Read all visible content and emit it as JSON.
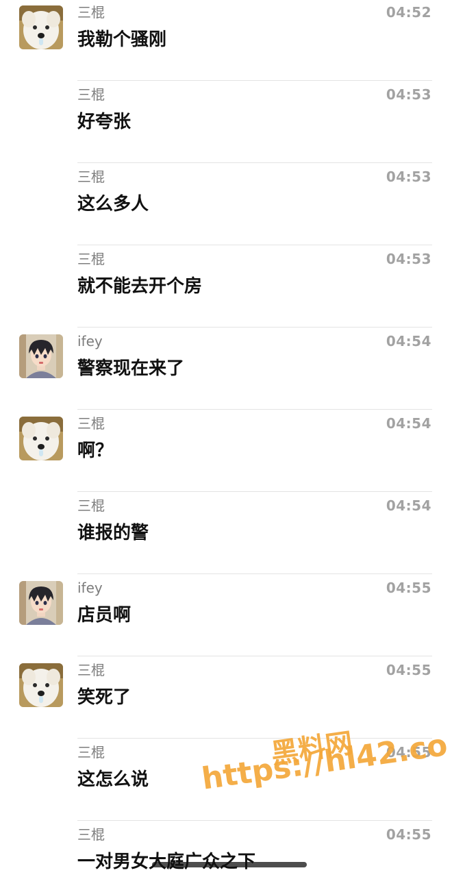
{
  "chat": {
    "messages": [
      {
        "sender": "三棍",
        "time": "04:52",
        "text": "我勒个骚刚",
        "avatar": "dog-avatar"
      },
      {
        "sender": "三棍",
        "time": "04:53",
        "text": "好夸张",
        "avatar": ""
      },
      {
        "sender": "三棍",
        "time": "04:53",
        "text": "这么多人",
        "avatar": ""
      },
      {
        "sender": "三棍",
        "time": "04:53",
        "text": "就不能去开个房",
        "avatar": ""
      },
      {
        "sender": "ifey",
        "time": "04:54",
        "text": "警察现在来了",
        "avatar": "anime-avatar"
      },
      {
        "sender": "三棍",
        "time": "04:54",
        "text": "啊？",
        "avatar": "dog-avatar"
      },
      {
        "sender": "三棍",
        "time": "04:54",
        "text": "谁报的警",
        "avatar": ""
      },
      {
        "sender": "ifey",
        "time": "04:55",
        "text": "店员啊",
        "avatar": "anime-avatar"
      },
      {
        "sender": "三棍",
        "time": "04:55",
        "text": "笑死了",
        "avatar": "dog-avatar"
      },
      {
        "sender": "三棍",
        "time": "04:55",
        "text": "这怎么说",
        "avatar": ""
      },
      {
        "sender": "三棍",
        "time": "04:55",
        "text": "一对男女大庭广众之下",
        "avatar": ""
      }
    ]
  },
  "watermark": {
    "title": "黑料网",
    "url": "https://hl42.co",
    "color": "#f4a83a"
  }
}
